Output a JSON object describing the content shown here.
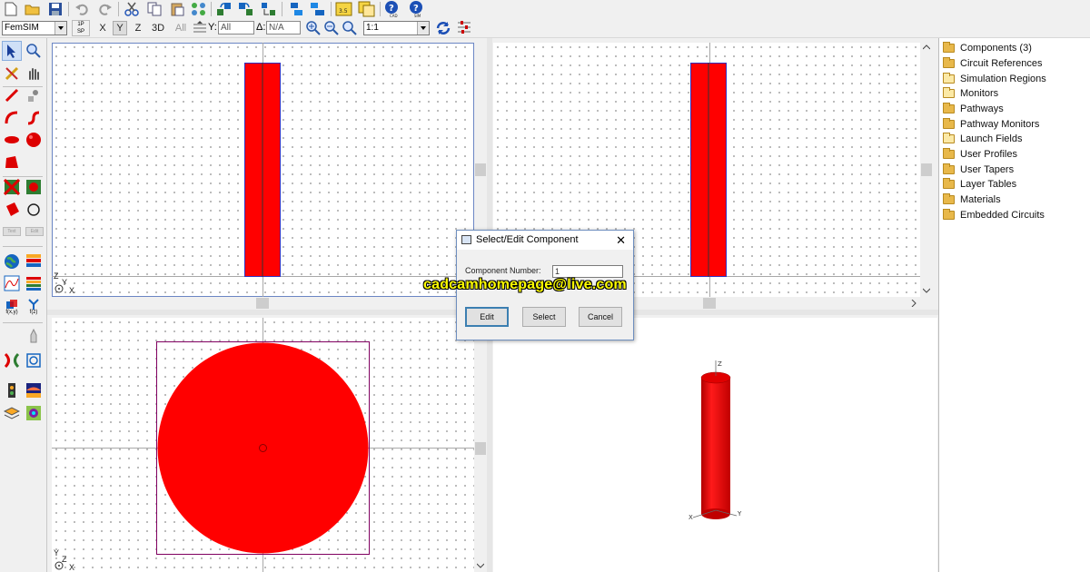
{
  "toolbar": {
    "mode_value": "FemSIM",
    "layer_top": "1P",
    "layer_bottom": "SP",
    "axes": [
      "X",
      "Y",
      "Z",
      "3D",
      "All"
    ],
    "selected_axis": "Y",
    "y_label": "Y:",
    "y_value": "All",
    "delta_label": "Δ:",
    "delta_value": "N/A",
    "zoom_value": "1:1",
    "help1_caption": "CAD",
    "help2_caption": "SIM",
    "gauge_caption": "3.5"
  },
  "palette": {
    "text_button_1": "Text",
    "text_button_2": "Edit",
    "fx_label_1": "f(x,y)",
    "fx_label_2": "f(z)"
  },
  "viewports": {
    "top_left_axes": [
      "Z",
      "Y",
      "X"
    ],
    "bottom_left_axes": [
      "Y",
      "Z",
      "X"
    ],
    "view3d_axes": [
      "Z",
      "Y",
      "X"
    ]
  },
  "tree": {
    "items": [
      {
        "label": "Components (3)",
        "filled": true
      },
      {
        "label": "Circuit References",
        "filled": true
      },
      {
        "label": "Simulation Regions",
        "filled": false
      },
      {
        "label": "Monitors",
        "filled": false
      },
      {
        "label": "Pathways",
        "filled": true
      },
      {
        "label": "Pathway Monitors",
        "filled": true
      },
      {
        "label": "Launch Fields",
        "filled": false
      },
      {
        "label": "User Profiles",
        "filled": true
      },
      {
        "label": "User Tapers",
        "filled": true
      },
      {
        "label": "Layer Tables",
        "filled": true
      },
      {
        "label": "Materials",
        "filled": true
      },
      {
        "label": "Embedded Circuits",
        "filled": true
      }
    ]
  },
  "dialog": {
    "title": "Select/Edit Component",
    "close_glyph": "✕",
    "field_label": "Component Number:",
    "field_value": "1",
    "edit_label": "Edit",
    "select_label": "Select",
    "cancel_label": "Cancel"
  },
  "watermark": "cadcamhomepage@live.com",
  "colors": {
    "shape_fill": "#ff0000",
    "shape_outline": "#3030c0",
    "bbox": "#800060",
    "accent": "#6b86c4"
  }
}
